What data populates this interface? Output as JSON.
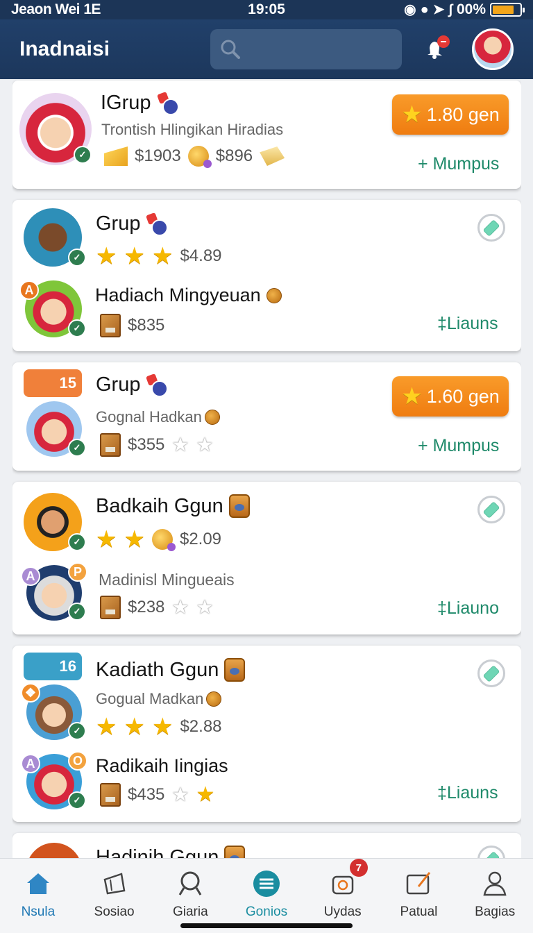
{
  "status_bar": {
    "carrier": "Jeaon Wei   1E",
    "time": "19:05",
    "battery_percent": "00%",
    "battery_level": 0.8,
    "icons": [
      "nfc-icon",
      "sync-icon",
      "location-icon",
      "bluetooth-icon",
      "battery-icon"
    ]
  },
  "header": {
    "title": "Inadnaisi",
    "search_placeholder": "",
    "icons": [
      "search-icon",
      "notification-icon",
      "profile-avatar"
    ]
  },
  "feed": {
    "cards": [
      {
        "title": "IGrup",
        "subtitle": "Trontish Hlingikan Hiradias",
        "values": [
          "$1903",
          "$896"
        ],
        "cta_label": "1.80 gen",
        "join_label": "+  Mumpus"
      },
      {
        "title": "Grup",
        "value_a": "$4.89",
        "second_title": "Hadiach Mingyeuan",
        "value_b": "$835",
        "join_label": "‡Liauns",
        "corner_badge": "A"
      },
      {
        "title": "Grup",
        "badge_number": "15",
        "subtitle": "Gognal Hadkan",
        "value": "$355",
        "cta_label": "1.60 gen",
        "join_label": "+  Mumpus"
      },
      {
        "title": "Badkaih Ggun",
        "value_a": "$2.09",
        "subtitle": "Madinisl Mingueais",
        "value_b": "$238",
        "join_label": "‡Liauno",
        "corner_badge_a": "A",
        "corner_badge_p": "P"
      },
      {
        "title": "Kadiath Ggun",
        "badge_number": "16",
        "subtitle": "Gogual Madkan",
        "value_a": "$2.88",
        "second_title": "Radikaih Iingias",
        "value_b": "$435",
        "join_label": "‡Liauns",
        "corner_badge_a": "A",
        "corner_badge_o": "O"
      },
      {
        "title": "Hadinih Ggun"
      }
    ]
  },
  "bottom_nav": {
    "items": [
      {
        "label": "Nsula",
        "icon": "home-icon"
      },
      {
        "label": "Sosiao",
        "icon": "megaphone-icon"
      },
      {
        "label": "Giaria",
        "icon": "search-icon"
      },
      {
        "label": "Gonios",
        "icon": "menu-icon"
      },
      {
        "label": "Uydas",
        "icon": "settings-icon",
        "badge": "7"
      },
      {
        "label": "Patual",
        "icon": "edit-icon"
      },
      {
        "label": "Bagias",
        "icon": "profile-icon"
      }
    ]
  },
  "colors": {
    "header_bg": "#1c3557",
    "cta_orange": "#f3861a",
    "join_green": "#1f8a6a",
    "nav_active": "#1f78b4"
  }
}
